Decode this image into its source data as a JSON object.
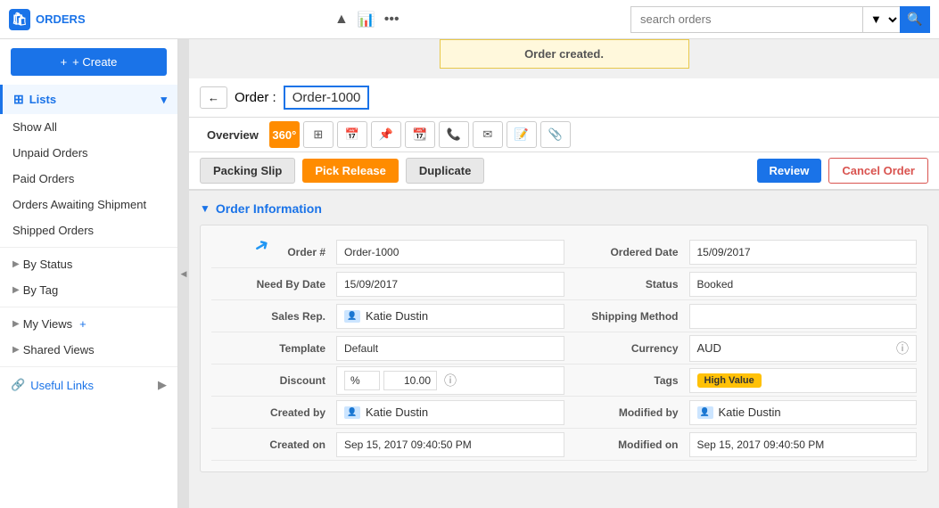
{
  "app": {
    "title": "ORDERS"
  },
  "topbar": {
    "search_placeholder": "search orders"
  },
  "sidebar": {
    "create_label": "+ Create",
    "section_label": "Lists",
    "nav_items": [
      {
        "label": "Show All"
      },
      {
        "label": "Unpaid Orders"
      },
      {
        "label": "Paid Orders"
      },
      {
        "label": "Orders Awaiting Shipment"
      },
      {
        "label": "Shipped Orders"
      }
    ],
    "group_items": [
      {
        "label": "By Status"
      },
      {
        "label": "By Tag"
      }
    ],
    "my_views_label": "My Views",
    "shared_views_label": "Shared Views",
    "useful_links_label": "Useful Links"
  },
  "notification": {
    "message": "Order created."
  },
  "order": {
    "back_label": "←",
    "title_prefix": "Order :",
    "order_id": "Order-1000",
    "toolbar_items": [
      {
        "label": "Overview"
      },
      {
        "label": "360°",
        "active": true
      },
      {
        "label": "⊞"
      },
      {
        "label": "📅"
      },
      {
        "label": "📌"
      },
      {
        "label": "📆"
      },
      {
        "label": "📞"
      },
      {
        "label": "✉"
      },
      {
        "label": "📝"
      },
      {
        "label": "📎"
      }
    ],
    "buttons": {
      "packing_slip": "Packing Slip",
      "pick_release": "Pick Release",
      "duplicate": "Duplicate",
      "review": "Review",
      "cancel_order": "Cancel Order"
    },
    "section_title": "Order Information",
    "fields": {
      "order_number_label": "Order #",
      "order_number_value": "Order-1000",
      "ordered_date_label": "Ordered Date",
      "ordered_date_value": "15/09/2017",
      "need_by_date_label": "Need By Date",
      "need_by_date_value": "15/09/2017",
      "status_label": "Status",
      "status_value": "Booked",
      "sales_rep_label": "Sales Rep.",
      "sales_rep_value": "Katie Dustin",
      "shipping_method_label": "Shipping Method",
      "shipping_method_value": "",
      "template_label": "Template",
      "template_value": "Default",
      "currency_label": "Currency",
      "currency_value": "AUD",
      "discount_label": "Discount",
      "discount_type": "%",
      "discount_value": "10.00",
      "tags_label": "Tags",
      "tags_value": "High Value",
      "created_by_label": "Created by",
      "created_by_value": "Katie Dustin",
      "modified_by_label": "Modified by",
      "modified_by_value": "Katie Dustin",
      "created_on_label": "Created on",
      "created_on_value": "Sep 15, 2017 09:40:50 PM",
      "modified_on_label": "Modified on",
      "modified_on_value": "Sep 15, 2017 09:40:50 PM"
    }
  }
}
